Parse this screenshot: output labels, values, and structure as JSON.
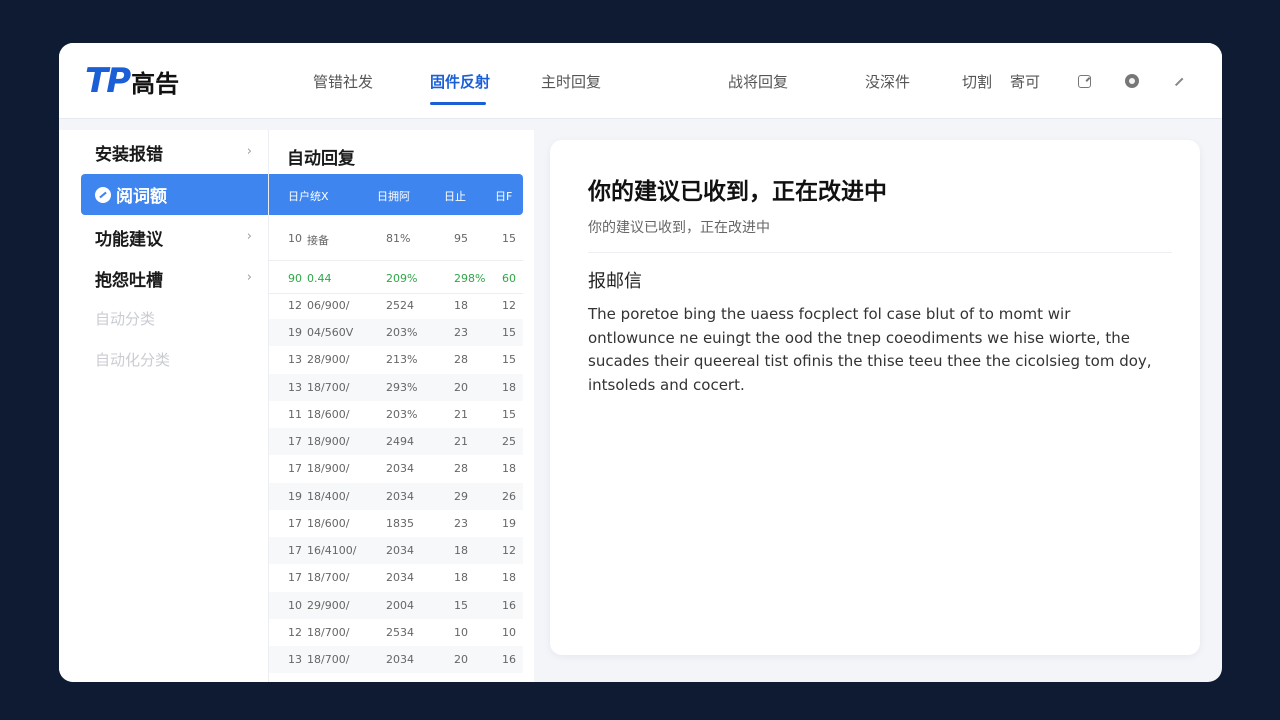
{
  "app": {
    "logo_mark": "TP",
    "logo_text": "高告"
  },
  "nav": {
    "items": [
      "管错社发",
      "固件反射",
      "主时回复",
      "战将回复",
      "没深件",
      "切割",
      "寄可"
    ],
    "active_index": 1
  },
  "sidebar": {
    "items": [
      {
        "label": "安装报错",
        "chevron": "›"
      },
      {
        "label": "阅词额",
        "selected": true
      },
      {
        "label": "功能建议",
        "chevron": "›"
      },
      {
        "label": "抱怨吐槽",
        "chevron": "›"
      },
      {
        "label": "自动分类"
      },
      {
        "label": "自动化分类"
      }
    ]
  },
  "table": {
    "title": "自动回复",
    "headers": [
      "日户统X",
      "日拥阿",
      "日止",
      "日F"
    ],
    "rows": [
      [
        "10",
        "接备",
        "81%",
        "95",
        "15"
      ],
      [
        "90",
        "0.44",
        "209%",
        "298%",
        "60"
      ],
      [
        "12",
        "06/900/",
        "2524",
        "18",
        "12"
      ],
      [
        "19",
        "04/560V",
        "203%",
        "23",
        "15"
      ],
      [
        "13",
        "28/900/",
        "213%",
        "28",
        "15"
      ],
      [
        "13",
        "18/700/",
        "293%",
        "20",
        "18"
      ],
      [
        "11",
        "18/600/",
        "203%",
        "21",
        "15"
      ],
      [
        "17",
        "18/900/",
        "2494",
        "21",
        "25"
      ],
      [
        "17",
        "18/900/",
        "2034",
        "28",
        "18"
      ],
      [
        "19",
        "18/400/",
        "2034",
        "29",
        "26"
      ],
      [
        "17",
        "18/600/",
        "1835",
        "23",
        "19"
      ],
      [
        "17",
        "16/4100/",
        "2034",
        "18",
        "12"
      ],
      [
        "17",
        "18/700/",
        "2034",
        "18",
        "18"
      ],
      [
        "10",
        "29/900/",
        "2004",
        "15",
        "16"
      ],
      [
        "12",
        "18/700/",
        "2534",
        "10",
        "10"
      ],
      [
        "13",
        "18/700/",
        "2034",
        "20",
        "16"
      ]
    ],
    "highlight_row": 1
  },
  "card": {
    "title": "你的建议已收到，正在改进中",
    "subtitle": "你的建议已收到，正在改进中",
    "heading": "报邮信",
    "body": "The poretoe bing the uaess focplect fol case blut of to momt wir ontlowunce ne euingt the ood the tnep coeodiments we hise wiorte, the sucades their queereal tist ofinis the thise teeu thee the cicolsieg tom doy, intsoleds and cocert."
  },
  "colors": {
    "accent": "#3f85ef",
    "brand": "#1b5fd6",
    "highlight_text": "#2fa64a",
    "backdrop": "#0f1a33"
  }
}
